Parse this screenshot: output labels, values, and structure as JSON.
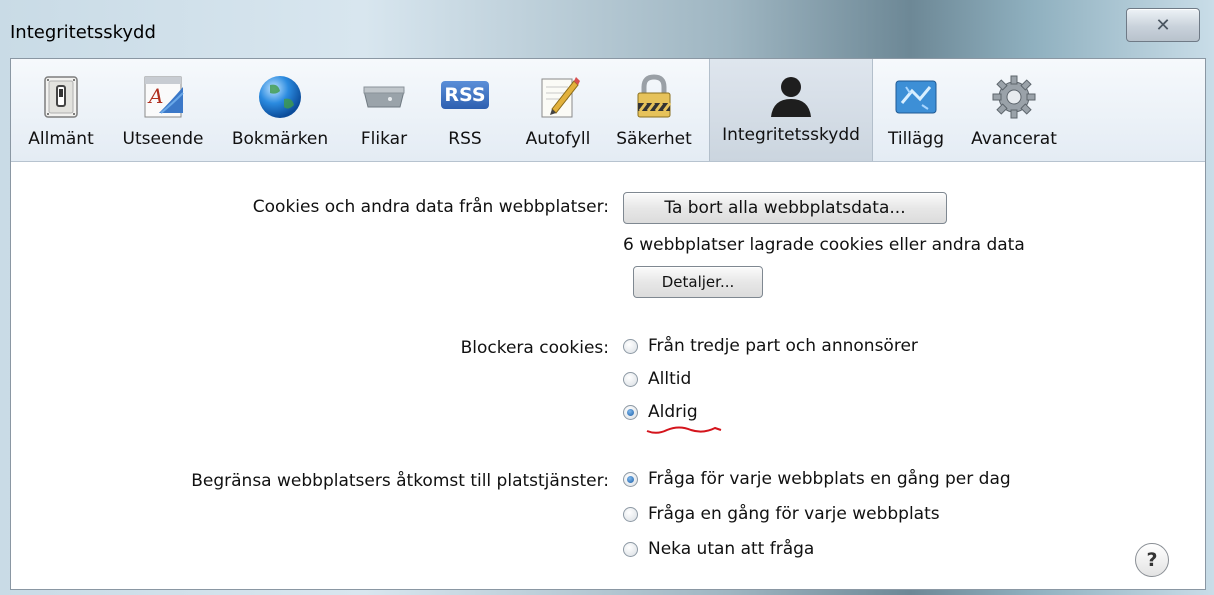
{
  "window": {
    "title": "Integritetsskydd"
  },
  "toolbar": {
    "items": [
      {
        "label": "Allmänt",
        "icon": "switch-icon"
      },
      {
        "label": "Utseende",
        "icon": "font-icon"
      },
      {
        "label": "Bokmärken",
        "icon": "globe-icon"
      },
      {
        "label": "Flikar",
        "icon": "tabs-icon"
      },
      {
        "label": "RSS",
        "icon": "rss-icon"
      },
      {
        "label": "Autofyll",
        "icon": "pencil-icon"
      },
      {
        "label": "Säkerhet",
        "icon": "lock-icon"
      },
      {
        "label": "Integritetsskydd",
        "icon": "person-icon"
      },
      {
        "label": "Tillägg",
        "icon": "puzzle-icon"
      },
      {
        "label": "Avancerat",
        "icon": "gear-icon"
      }
    ],
    "rss_badge": "RSS",
    "selected": "Integritetsskydd"
  },
  "cookies": {
    "label": "Cookies och andra data från webbplatser:",
    "remove_button": "Ta bort alla webbplatsdata...",
    "info": "6 webbplatser lagrade cookies eller andra data",
    "details_button": "Detaljer..."
  },
  "block_cookies": {
    "label": "Blockera cookies:",
    "options": [
      {
        "label": "Från tredje part och annonsörer",
        "selected": false
      },
      {
        "label": "Alltid",
        "selected": false
      },
      {
        "label": "Aldrig",
        "selected": true
      }
    ]
  },
  "location": {
    "label": "Begränsa webbplatsers åtkomst till platstjänster:",
    "options": [
      {
        "label": "Fråga för varje webbplats en gång per dag",
        "selected": true
      },
      {
        "label": "Fråga en gång för varje webbplats",
        "selected": false
      },
      {
        "label": "Neka utan att fråga",
        "selected": false
      }
    ]
  },
  "help": {
    "label": "?"
  },
  "colors": {
    "accent": "#1d5fa8",
    "annotation": "#d4141c"
  }
}
